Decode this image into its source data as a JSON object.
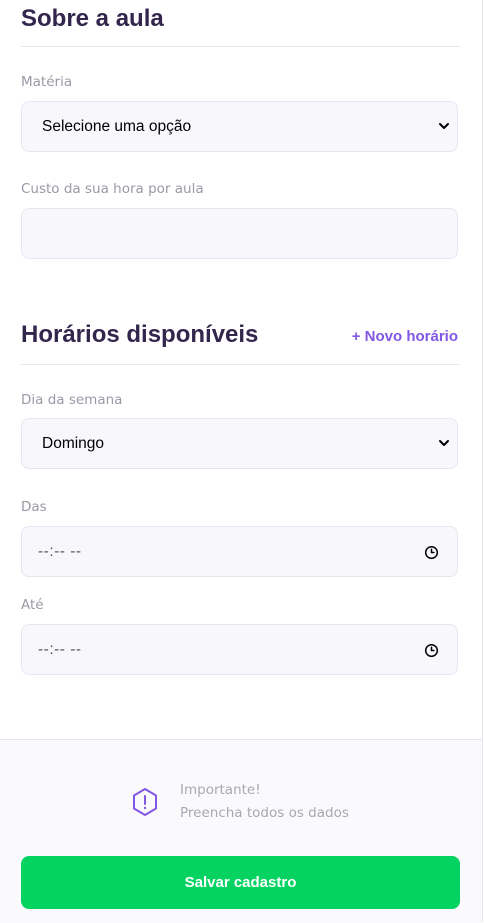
{
  "about": {
    "title": "Sobre a aula",
    "subject_label": "Matéria",
    "subject_value": "Selecione uma opção",
    "cost_label": "Custo da sua hora por aula",
    "cost_value": ""
  },
  "schedule": {
    "title": "Horários disponíveis",
    "new_link": "+ Novo horário",
    "weekday_label": "Dia da semana",
    "weekday_value": "Domingo",
    "from_label": "Das",
    "from_value": "--:-- --",
    "to_label": "Até",
    "to_value": "--:-- --"
  },
  "footer": {
    "warning_title": "Importante!",
    "warning_text": "Preencha todos os dados",
    "save_label": "Salvar cadastro"
  },
  "colors": {
    "primary": "#8257e5",
    "success": "#04d361",
    "title": "#32264d",
    "muted": "#9c98a6",
    "input_bg": "#f8f8fc",
    "line": "#e6e6f0"
  },
  "icons": {
    "select_arrow": "chevron-down-icon",
    "time": "clock-icon",
    "warning": "warning-icon"
  }
}
